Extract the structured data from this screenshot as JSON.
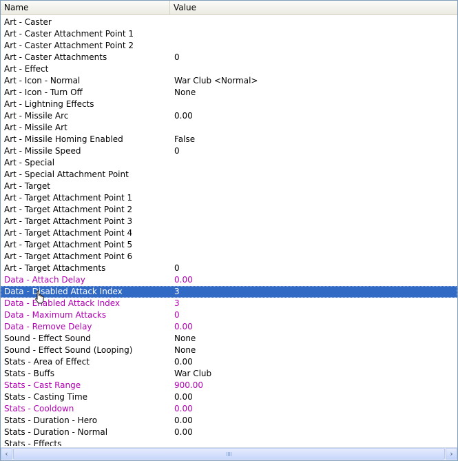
{
  "columns": {
    "name": "Name",
    "value": "Value"
  },
  "rows": [
    {
      "name": "Art - Caster",
      "value": ""
    },
    {
      "name": "Art - Caster Attachment Point 1",
      "value": ""
    },
    {
      "name": "Art - Caster Attachment Point 2",
      "value": ""
    },
    {
      "name": "Art - Caster Attachments",
      "value": "0"
    },
    {
      "name": "Art - Effect",
      "value": ""
    },
    {
      "name": "Art - Icon - Normal",
      "value": "War Club <Normal>"
    },
    {
      "name": "Art - Icon - Turn Off",
      "value": "None"
    },
    {
      "name": "Art - Lightning Effects",
      "value": ""
    },
    {
      "name": "Art - Missile Arc",
      "value": "0.00"
    },
    {
      "name": "Art - Missile Art",
      "value": ""
    },
    {
      "name": "Art - Missile Homing Enabled",
      "value": "False"
    },
    {
      "name": "Art - Missile Speed",
      "value": "0"
    },
    {
      "name": "Art - Special",
      "value": ""
    },
    {
      "name": "Art - Special Attachment Point",
      "value": ""
    },
    {
      "name": "Art - Target",
      "value": ""
    },
    {
      "name": "Art - Target Attachment Point 1",
      "value": ""
    },
    {
      "name": "Art - Target Attachment Point 2",
      "value": ""
    },
    {
      "name": "Art - Target Attachment Point 3",
      "value": ""
    },
    {
      "name": "Art - Target Attachment Point 4",
      "value": ""
    },
    {
      "name": "Art - Target Attachment Point 5",
      "value": ""
    },
    {
      "name": "Art - Target Attachment Point 6",
      "value": ""
    },
    {
      "name": "Art - Target Attachments",
      "value": "0"
    },
    {
      "name": "Data - Attach Delay",
      "value": "0.00",
      "modified": true
    },
    {
      "name": "Data - Disabled Attack Index",
      "value": "3",
      "modified": true,
      "selected": true
    },
    {
      "name": "Data - Enabled Attack Index",
      "value": "3",
      "modified": true
    },
    {
      "name": "Data - Maximum Attacks",
      "value": "0",
      "modified": true
    },
    {
      "name": "Data - Remove Delay",
      "value": "0.00",
      "modified": true
    },
    {
      "name": "Sound - Effect Sound",
      "value": "None"
    },
    {
      "name": "Sound - Effect Sound (Looping)",
      "value": "None"
    },
    {
      "name": "Stats - Area of Effect",
      "value": "0.00"
    },
    {
      "name": "Stats - Buffs",
      "value": "War Club"
    },
    {
      "name": "Stats - Cast Range",
      "value": "900.00",
      "modified": true
    },
    {
      "name": "Stats - Casting Time",
      "value": "0.00"
    },
    {
      "name": "Stats - Cooldown",
      "value": "0.00",
      "modified": true
    },
    {
      "name": "Stats - Duration - Hero",
      "value": "0.00"
    },
    {
      "name": "Stats - Duration - Normal",
      "value": "0.00"
    },
    {
      "name": "Stats - Effects",
      "value": ""
    }
  ],
  "scrollbar": {
    "left_glyph": "‹",
    "right_glyph": "›",
    "icons": [
      "scroll-left-icon",
      "scroll-right-icon",
      "grip-icon"
    ]
  },
  "cursor_icon": "hand-pointer-icon",
  "colors": {
    "modified": "#b000b0",
    "selection": "#316ac5"
  }
}
